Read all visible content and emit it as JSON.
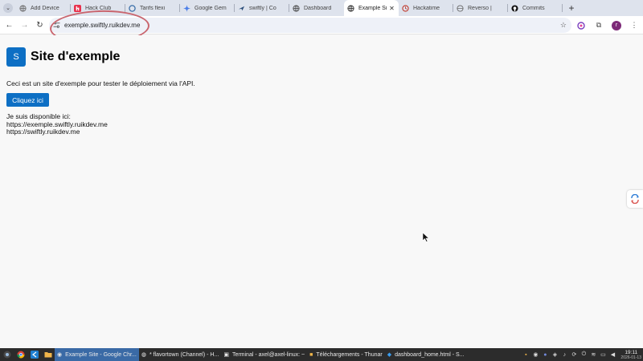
{
  "browser": {
    "tabs": [
      {
        "title": "Add Device",
        "icon": "globe-icon",
        "active": false
      },
      {
        "title": "Hack Club",
        "icon": "hackclub-icon",
        "active": false
      },
      {
        "title": "Tarifs flexi",
        "icon": "flexi-icon",
        "active": false
      },
      {
        "title": "Google Gem",
        "icon": "gemini-icon",
        "active": false
      },
      {
        "title": "swiftly | Co",
        "icon": "swiftly-icon",
        "active": false
      },
      {
        "title": "Dashboard",
        "icon": "globe-icon",
        "active": false
      },
      {
        "title": "Example Si",
        "icon": "globe-icon",
        "active": true
      },
      {
        "title": "Hackatime",
        "icon": "hackatime-icon",
        "active": false
      },
      {
        "title": "Reverso |",
        "icon": "reverso-icon",
        "active": false
      },
      {
        "title": "Commits",
        "icon": "github-icon",
        "active": false
      }
    ],
    "url": "exemple.swiftly.ruikdev.me",
    "profile_initial": "r"
  },
  "page": {
    "logo_letter": "S",
    "title": "Site d'exemple",
    "description": "Ceci est un site d'exemple pour tester le déploiement via l'API.",
    "button_label": "Cliquez ici",
    "available_label": "Je suis disponible ici:",
    "links": [
      "https://exemple.swiftly.ruikdev.me",
      "https://swiftly.ruikdev.me"
    ]
  },
  "taskbar": {
    "items": [
      {
        "label": "Example Site - Google Chr...",
        "icon": "chrome-icon",
        "active": true
      },
      {
        "label": "* flavortown (Channel) - H...",
        "icon": "slack-icon",
        "active": false
      },
      {
        "label": "Terminal - axel@axel-linux: ~",
        "icon": "terminal-icon",
        "active": false
      },
      {
        "label": "Téléchargements - Thunar",
        "icon": "folder-icon",
        "active": false
      },
      {
        "label": "dashboard_home.html - S...",
        "icon": "vscode-icon",
        "active": false
      }
    ],
    "time": "19:11",
    "date": "2026-01-13"
  },
  "colors": {
    "accent": "#0d6fc4",
    "annotation": "#c9656e",
    "taskbar": "#2c2c2c",
    "taskbar_active": "#3a6aa6",
    "tabstrip": "#dee3ed",
    "avatar": "#7d2a78"
  }
}
